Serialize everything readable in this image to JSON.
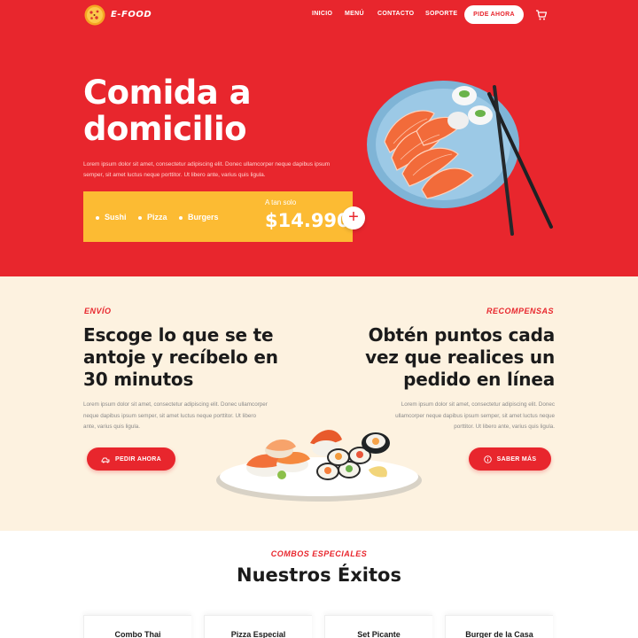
{
  "nav": {
    "brand": "E-FOOD",
    "links": [
      "INICIO",
      "MENÚ",
      "CONTACTO",
      "SOPORTE"
    ],
    "order_button": "PIDE AHORA",
    "cart_icon": "cart-icon"
  },
  "hero": {
    "title": "Comida a domicilio",
    "text": "Lorem ipsum dolor sit amet, consectetur adipiscing elit. Donec ullamcorper neque dapibus ipsum semper, sit amet luctus neque porttitor. Ut libero ante, varius quis ligula.",
    "promo": {
      "items": [
        "Sushi",
        "Pizza",
        "Burgers"
      ],
      "small_label": "A tan solo",
      "price": "$14.990",
      "plus_icon": "plus-icon"
    }
  },
  "sections": {
    "left": {
      "eyebrow": "ENVÍO",
      "title": "Escoge lo que se te antoje y recíbelo en 30 minutos",
      "text": "Lorem ipsum dolor sit amet, consectetur adipiscing elit. Donec ullamcorper neque dapibus ipsum semper, sit amet luctus neque porttitor. Ut libero ante, varius quis ligula.",
      "button": "PEDIR AHORA",
      "button_icon": "delivery-icon"
    },
    "right": {
      "eyebrow": "RECOMPENSAS",
      "title": "Obtén puntos cada vez que realices un pedido en línea",
      "text": "Lorem ipsum dolor sit amet, consectetur adipiscing elit. Donec ullamcorper neque dapibus ipsum semper, sit amet luctus neque porttitor. Ut libero ante, varius quis ligula.",
      "button": "SABER MÁS",
      "button_icon": "info-icon"
    }
  },
  "combos": {
    "eyebrow": "COMBOS ESPECIALES",
    "title": "Nuestros Éxitos",
    "cards": [
      "Combo Thai",
      "Pizza Especial",
      "Set Picante",
      "Burger de la Casa"
    ]
  },
  "colors": {
    "primary_red": "#e8262d",
    "promo_yellow": "#fcbb33",
    "section_cream": "#fdf2e0"
  }
}
